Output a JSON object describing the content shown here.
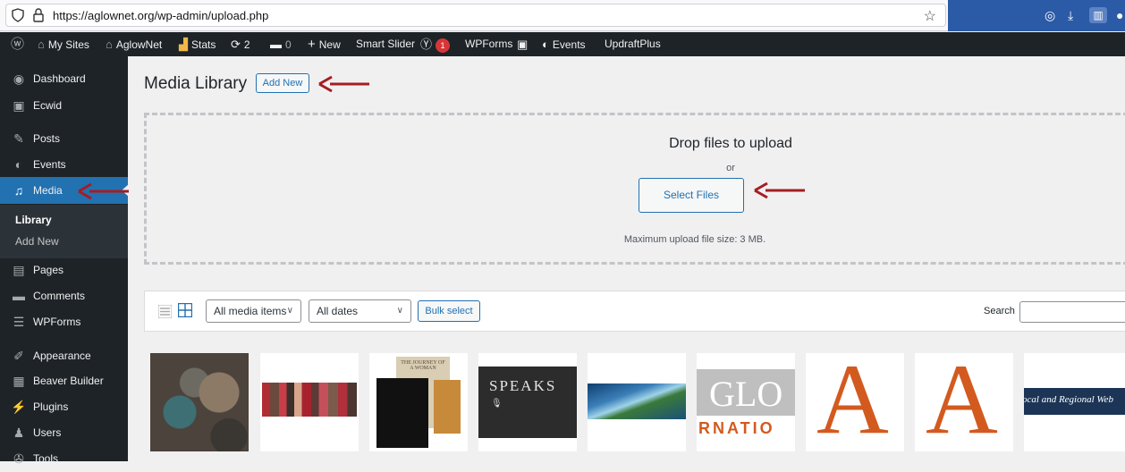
{
  "browser": {
    "url": "https://aglownet.org/wp-admin/upload.php"
  },
  "adminbar": {
    "my_sites": "My Sites",
    "site_name": "AglowNet",
    "stats": "Stats",
    "updates_count": "2",
    "comments_count": "0",
    "new_label": "New",
    "smart_slider": "Smart Slider",
    "yoast_badge": "1",
    "wpforms": "WPForms",
    "events": "Events",
    "updraft": "UpdraftPlus"
  },
  "sidebar": {
    "items": [
      {
        "label": "Dashboard",
        "icon": "dashboard-icon"
      },
      {
        "label": "Ecwid",
        "icon": "ecwid-icon"
      },
      {
        "label": "Posts",
        "icon": "pin-icon"
      },
      {
        "label": "Events",
        "icon": "calendar-icon"
      },
      {
        "label": "Media",
        "icon": "media-icon"
      },
      {
        "label": "Pages",
        "icon": "pages-icon"
      },
      {
        "label": "Comments",
        "icon": "comment-icon"
      },
      {
        "label": "WPForms",
        "icon": "forms-icon"
      },
      {
        "label": "Appearance",
        "icon": "brush-icon"
      },
      {
        "label": "Beaver Builder",
        "icon": "builder-icon"
      },
      {
        "label": "Plugins",
        "icon": "plug-icon"
      },
      {
        "label": "Users",
        "icon": "users-icon"
      },
      {
        "label": "Tools",
        "icon": "wrench-icon"
      }
    ],
    "submenu": [
      "Library",
      "Add New"
    ]
  },
  "main": {
    "title": "Media Library",
    "add_new": "Add New",
    "drop_title": "Drop files to upload",
    "drop_or": "or",
    "select_files": "Select Files",
    "max_size": "Maximum upload file size: 3 MB."
  },
  "toolbar": {
    "filter_type": "All media items",
    "filter_date": "All dates",
    "bulk_select": "Bulk select",
    "search_label": "Search",
    "search_value": ""
  },
  "thumbs": {
    "book_title": "THE JOURNEY OF A WOMAN",
    "speaks": "SPEAKS",
    "glo": "GLO",
    "rnatio": "RNATIO",
    "letter_a": "A",
    "regional": "ocal and Regional Web"
  },
  "colors": {
    "admin_dark": "#1d2327",
    "accent": "#2271b1",
    "arrow_red": "#a51d22",
    "letter_orange": "#d35a1f"
  }
}
